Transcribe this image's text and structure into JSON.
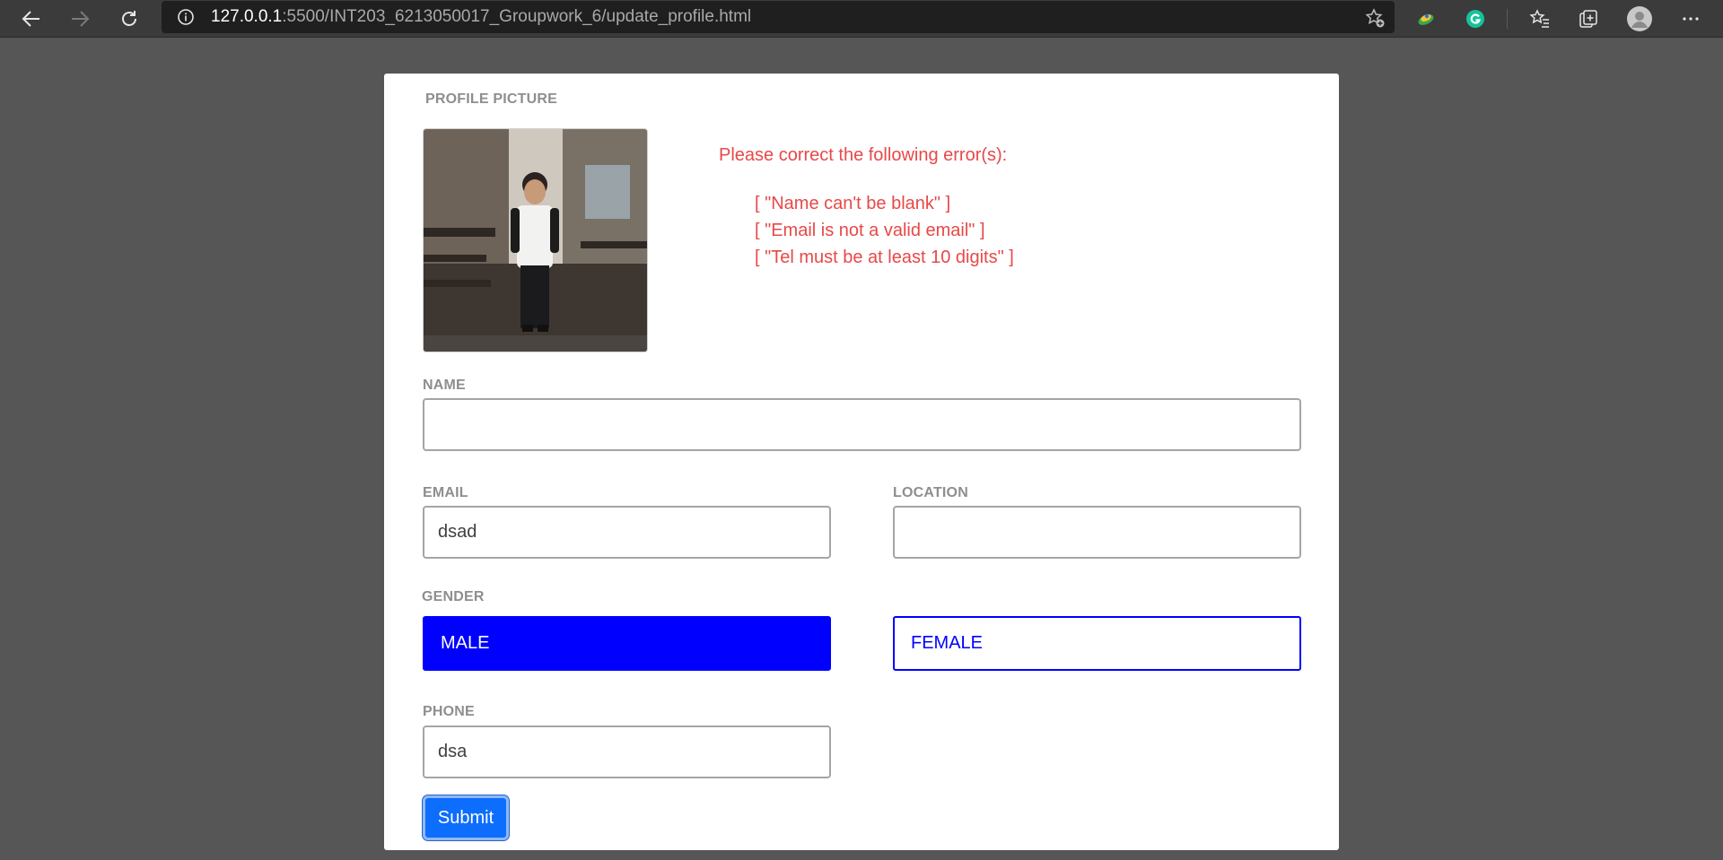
{
  "browser": {
    "url_host": "127.0.0.1",
    "url_rest": ":5500/INT203_6213050017_Groupwork_6/update_profile.html",
    "icons": [
      "back-arrow-icon",
      "forward-arrow-icon",
      "reload-icon",
      "info-icon",
      "add-favorite-icon",
      "extension-icon",
      "grammarly-icon",
      "favorites-icon",
      "collections-icon",
      "profile-icon",
      "more-icon"
    ]
  },
  "form": {
    "profile_picture_label": "PROFILE PICTURE",
    "errors": {
      "title": "Please correct the following error(s):",
      "items": [
        "[ \"Name can't be blank\" ]",
        "[ \"Email is not a valid email\" ]",
        "[ \"Tel must be at least 10 digits\" ]"
      ],
      "color": "#e84848"
    },
    "name": {
      "label": "NAME",
      "value": ""
    },
    "email": {
      "label": "EMAIL",
      "value": "dsad"
    },
    "location": {
      "label": "LOCATION",
      "value": ""
    },
    "gender": {
      "label": "GENDER",
      "options": [
        "MALE",
        "FEMALE"
      ],
      "selected": "MALE",
      "accent": "#0000ff"
    },
    "phone": {
      "label": "PHONE",
      "value": "dsa"
    },
    "submit_label": "Submit",
    "submit_color": "#0d6efd"
  }
}
